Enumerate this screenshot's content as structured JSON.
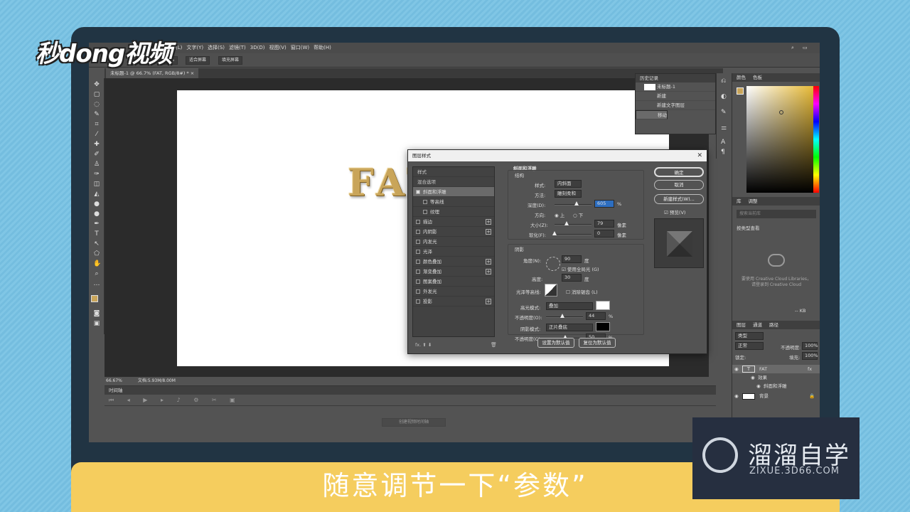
{
  "brand": "秒dong视频",
  "subtitle": "随意调节一下“参数”",
  "watermark": {
    "title": "溜溜自学",
    "url": "ZIXUE.3D66.COM"
  },
  "menu": [
    "图层(L)",
    "文字(Y)",
    "选择(S)",
    "滤镜(T)",
    "3D(D)",
    "视图(V)",
    "窗口(W)",
    "帮助(H)"
  ],
  "options_bar": {
    "zoom": "100%",
    "fit": "适合屏幕",
    "fill": "填充屏幕"
  },
  "document_tab": "未标题-1 @ 66.7% (FAT, RGB/8#) *",
  "canvas_text": "FAT",
  "status": {
    "zoom": "66.67%",
    "doc": "文档:5.93M/8.00M"
  },
  "timeline": {
    "title": "时间轴",
    "create": "创建视频时间轴"
  },
  "history": {
    "title": "历史记录",
    "doc": "未标题-1",
    "items": [
      "新建",
      "新建文字图层",
      "移动"
    ]
  },
  "color_panel": {
    "tabs": [
      "颜色",
      "色板"
    ],
    "fg": "#c9a55a"
  },
  "library_panel": {
    "tabs": [
      "库",
      "调整"
    ],
    "search": "搜索当前库",
    "view_by": "按类型查看",
    "msg1": "要使用 Creative Cloud Libraries，",
    "msg2": "请登录到 Creative Cloud",
    "size": "-- KB"
  },
  "layers_panel": {
    "tabs": [
      "图层",
      "通道",
      "路径"
    ],
    "kind": "类型",
    "mode": "正常",
    "opacity_label": "不透明度:",
    "opacity": "100%",
    "lock_label": "锁定:",
    "fill_label": "填充:",
    "fill": "100%",
    "layers": [
      {
        "name": "FAT",
        "fx": "fx"
      },
      {
        "name": "效果"
      },
      {
        "name": "斜面和浮雕"
      },
      {
        "name": "背景"
      }
    ]
  },
  "dialog": {
    "title": "图层样式",
    "left_items": [
      {
        "label": "样式",
        "header": true
      },
      {
        "label": "混合选项",
        "header": true
      },
      {
        "label": "斜面和浮雕",
        "checked": true,
        "selected": true
      },
      {
        "label": "等高线",
        "sub": true
      },
      {
        "label": "纹理",
        "sub": true
      },
      {
        "label": "描边",
        "plus": true
      },
      {
        "label": "内阴影",
        "plus": true
      },
      {
        "label": "内发光"
      },
      {
        "label": "光泽"
      },
      {
        "label": "颜色叠加",
        "plus": true
      },
      {
        "label": "渐变叠加",
        "plus": true
      },
      {
        "label": "图案叠加"
      },
      {
        "label": "外发光"
      },
      {
        "label": "投影",
        "plus": true
      }
    ],
    "section": "斜面和浮雕",
    "structure": "结构",
    "style_label": "样式:",
    "style": "内斜面",
    "technique_label": "方法:",
    "technique": "雕刻柔和",
    "depth_label": "深度(D):",
    "depth": "605",
    "pct": "%",
    "direction_label": "方向:",
    "dir_up": "上",
    "dir_down": "下",
    "size_label": "大小(Z):",
    "size": "79",
    "px": "像素",
    "soften_label": "软化(F):",
    "soften": "0",
    "shading": "阴影",
    "angle_label": "角度(N):",
    "angle": "90",
    "deg": "度",
    "global_light": "使用全局光 (G)",
    "altitude_label": "高度:",
    "altitude": "30",
    "gloss_label": "光泽等高线:",
    "antialias": "消除锯齿 (L)",
    "highlight_label": "高光模式:",
    "highlight_mode": "叠加",
    "hl_opacity_label": "不透明度(O):",
    "hl_opacity": "44",
    "shadow_label": "阴影模式:",
    "shadow_mode": "正片叠底",
    "sh_opacity_label": "不透明度(C):",
    "sh_opacity": "50",
    "set_default": "设置为默认值",
    "reset_default": "复位为默认值",
    "ok": "确定",
    "cancel": "取消",
    "new_style": "新建样式(W)...",
    "preview": "预览(V)",
    "fx": "fx.",
    "colors": {
      "highlight": "#ffffff",
      "shadow": "#000000"
    }
  }
}
